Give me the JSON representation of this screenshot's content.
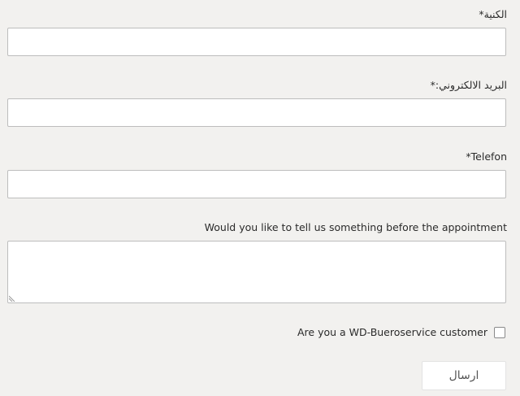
{
  "form": {
    "fields": [
      {
        "label": "الكنية*",
        "value": "",
        "placeholder": ""
      },
      {
        "label": "البريد الالكتروني:*",
        "value": "",
        "placeholder": ""
      },
      {
        "label": "*Telefon",
        "value": "",
        "placeholder": ""
      }
    ],
    "message": {
      "label": "Would you like to tell us something before the appointment",
      "value": "",
      "placeholder": ""
    },
    "customer_checkbox": {
      "label": "Are you a WD-Bueroservice customer",
      "checked": false
    },
    "submit_label": "ارسال"
  },
  "colors": {
    "background": "#f2f1ef",
    "input_border": "#bdbdbd",
    "text": "#2b2b2b"
  }
}
